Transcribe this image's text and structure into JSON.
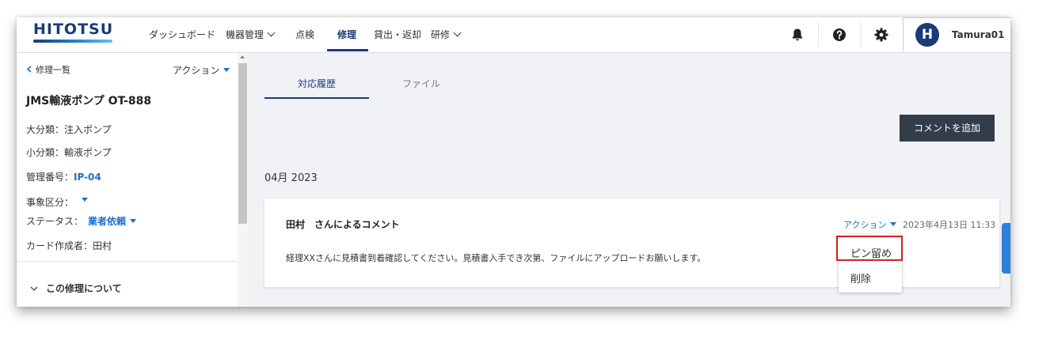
{
  "header": {
    "logo": "HITOTSU",
    "nav": [
      {
        "label": "ダッシュボード"
      },
      {
        "label": "機器管理"
      },
      {
        "label": "点検"
      },
      {
        "label": "修理"
      },
      {
        "label": "貸出・返却"
      },
      {
        "label": "研修"
      }
    ],
    "active_nav": "修理",
    "user": {
      "initial": "H",
      "name": "Tamura01"
    }
  },
  "sidebar": {
    "back_link": "修理一覧",
    "action_label": "アクション",
    "title": "JMS輸液ポンプ OT-888",
    "major_category": "大分類：注入ポンプ",
    "minor_category": "小分類：輸液ポンプ",
    "management_number_label": "管理番号：",
    "management_number_value": "IP-04",
    "incident_type_label": "事象区分：",
    "status_label": "ステータス：",
    "status_value": "業者依頼",
    "creator": "カード作成者：田村",
    "section_toggle": "この修理について"
  },
  "main": {
    "tabs": [
      {
        "label": "対応履歴"
      },
      {
        "label": "ファイル"
      }
    ],
    "add_comment_button": "コメントを追加",
    "month_heading": "04月 2023",
    "comment": {
      "author": "田村　さんによるコメント",
      "action_label": "アクション",
      "date": "2023年4月13日 11:33",
      "body": "経理XXさんに見積書到着確認してください。見積書入手でき次第、ファイルにアップロードお願いします。"
    },
    "action_menu": [
      {
        "label": "ピン留め"
      },
      {
        "label": "削除"
      }
    ]
  },
  "colors": {
    "brand": "#1a3a78",
    "link": "#1a6fd1",
    "highlight": "#d42020",
    "button": "#333d4a"
  }
}
